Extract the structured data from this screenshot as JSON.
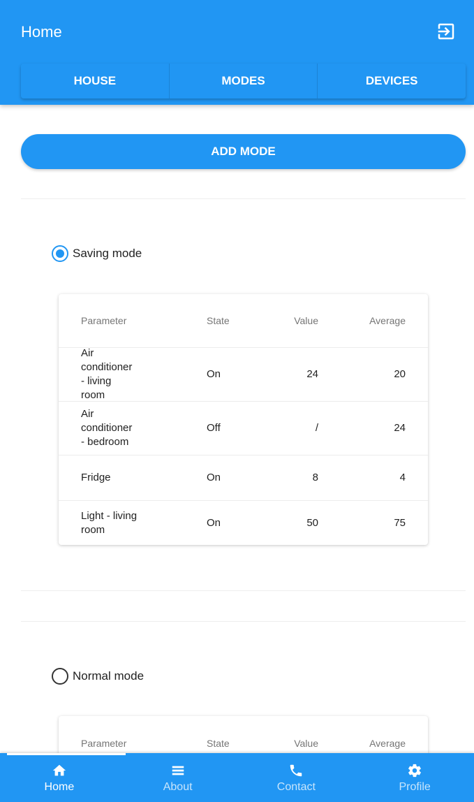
{
  "appbar": {
    "title": "Home",
    "logout_icon": "logout-icon"
  },
  "tabs": [
    {
      "label": "HOUSE"
    },
    {
      "label": "MODES"
    },
    {
      "label": "DEVICES"
    }
  ],
  "add_mode_label": "ADD MODE",
  "modes": [
    {
      "name": "Saving mode",
      "selected": true,
      "columns": [
        "Parameter",
        "State",
        "Value",
        "Average"
      ],
      "rows": [
        {
          "parameter": "Air conditioner - living room",
          "state": "On",
          "value": "24",
          "average": "20"
        },
        {
          "parameter": "Air conditioner - bedroom",
          "state": "Off",
          "value": "/",
          "average": "24"
        },
        {
          "parameter": "Fridge",
          "state": "On",
          "value": "8",
          "average": "4"
        },
        {
          "parameter": "Light - living room",
          "state": "On",
          "value": "50",
          "average": "75"
        }
      ]
    },
    {
      "name": "Normal mode",
      "selected": false,
      "columns": [
        "Parameter",
        "State",
        "Value",
        "Average"
      ]
    }
  ],
  "bottom_nav": [
    {
      "label": "Home",
      "icon": "home-icon",
      "active": true
    },
    {
      "label": "About",
      "icon": "list-icon",
      "active": false
    },
    {
      "label": "Contact",
      "icon": "phone-icon",
      "active": false
    },
    {
      "label": "Profile",
      "icon": "gear-icon",
      "active": false
    }
  ],
  "colors": {
    "primary": "#2196f3",
    "text": "#212121"
  }
}
